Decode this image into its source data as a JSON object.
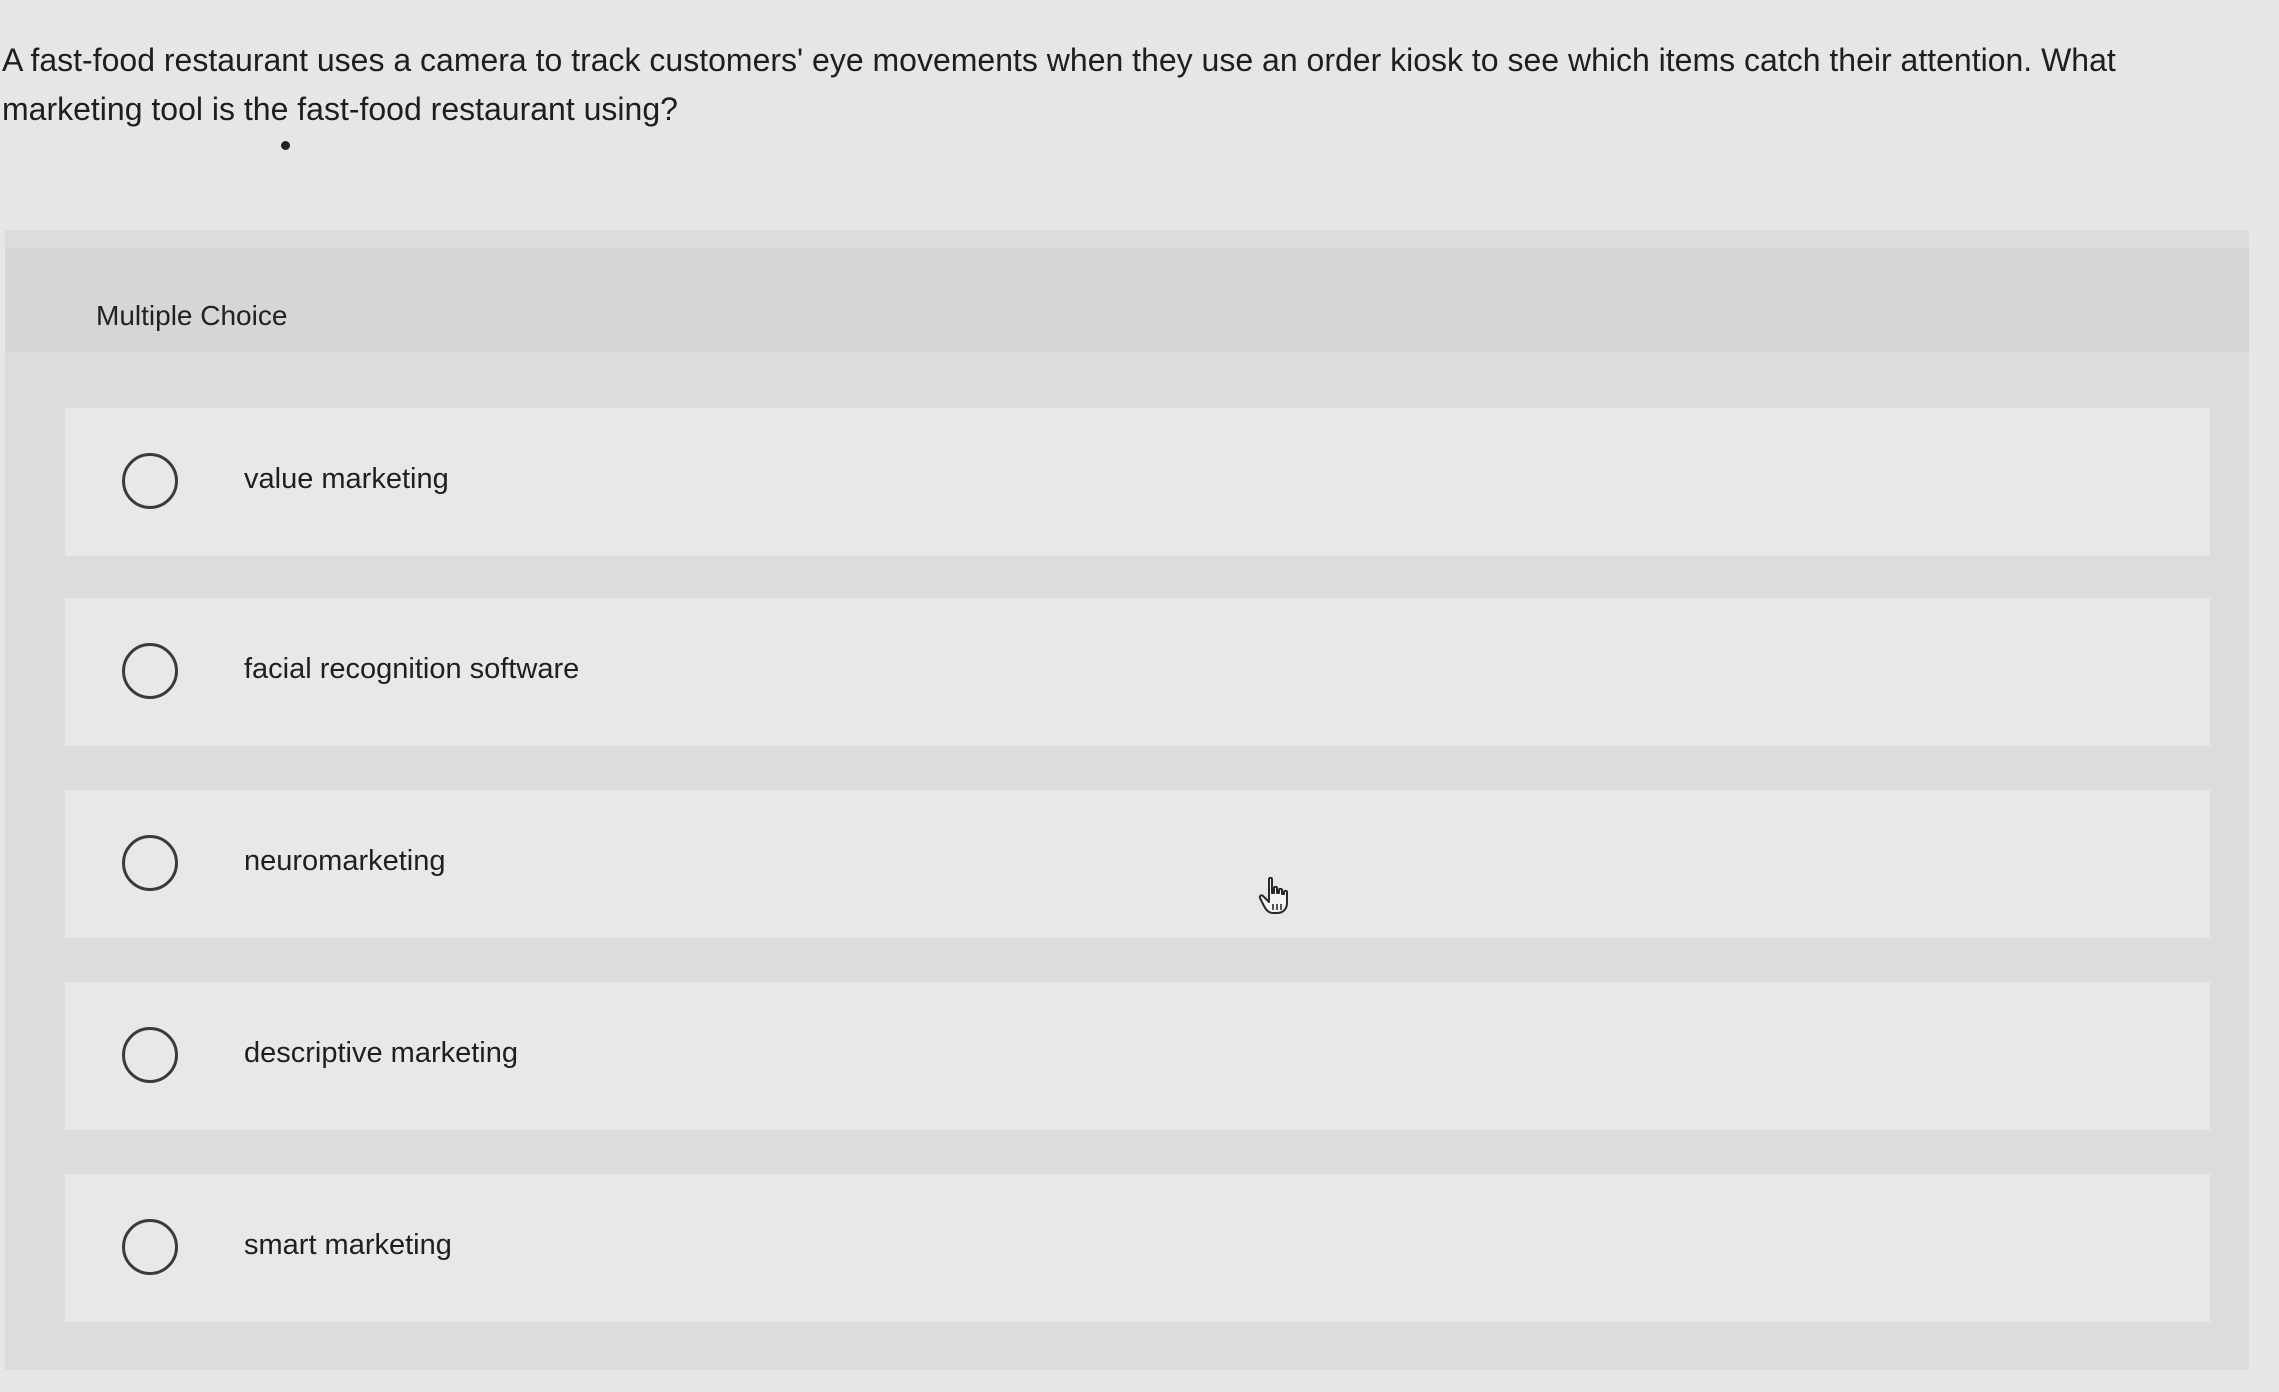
{
  "question": {
    "line1": "A fast-food restaurant uses a camera to track customers' eye movements when they use an order kiosk to see which items catch their attention. What",
    "line2": "marketing tool is the fast-food restaurant using?"
  },
  "section_label": "Multiple Choice",
  "options": [
    {
      "label": "value marketing",
      "selected": false
    },
    {
      "label": "facial recognition software",
      "selected": false
    },
    {
      "label": "neuromarketing",
      "selected": false
    },
    {
      "label": "descriptive marketing",
      "selected": false
    },
    {
      "label": "smart marketing",
      "selected": false
    }
  ],
  "icons": {
    "radio": "radio-unchecked-icon",
    "cursor": "hand-pointer-icon"
  }
}
